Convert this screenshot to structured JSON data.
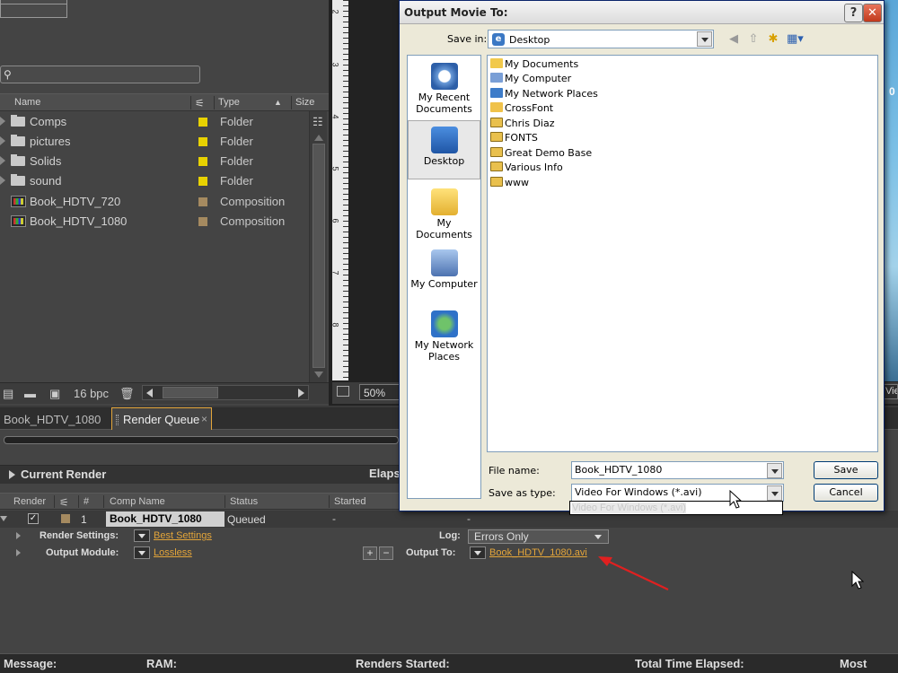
{
  "project_panel": {
    "search": {
      "placeholder": "",
      "value": ""
    },
    "columns": {
      "name": "Name",
      "type": "Type",
      "size": "Size"
    },
    "items": [
      {
        "name": "Comps",
        "type": "Folder",
        "kind": "folder",
        "label_color": "#e8d200"
      },
      {
        "name": "pictures",
        "type": "Folder",
        "kind": "folder",
        "label_color": "#e8d200"
      },
      {
        "name": "Solids",
        "type": "Folder",
        "kind": "folder",
        "label_color": "#e8d200"
      },
      {
        "name": "sound",
        "type": "Folder",
        "kind": "folder",
        "label_color": "#e8d200"
      },
      {
        "name": "Book_HDTV_720",
        "type": "Composition",
        "kind": "composition",
        "label_color": "#a58a60"
      },
      {
        "name": "Book_HDTV_1080",
        "type": "Composition",
        "kind": "composition",
        "label_color": "#a58a60"
      }
    ],
    "footer": {
      "bpc": "16 bpc"
    }
  },
  "viewer": {
    "zoom": "50%",
    "ruler_numbers": [
      "2",
      "3",
      "4",
      "5",
      "6",
      "7",
      "8"
    ],
    "view_label": "Vie",
    "edge_text": "0"
  },
  "render_queue": {
    "tabs": {
      "comp_tab": "Book_HDTV_1080",
      "render_queue_tab": "Render Queue",
      "close": "×"
    },
    "current_render": "Current Render",
    "elapsed": "Elaps",
    "headers": {
      "render": "Render",
      "number": "#",
      "comp_name": "Comp Name",
      "status": "Status",
      "started": "Started"
    },
    "item": {
      "number": "1",
      "comp_name": "Book_HDTV_1080",
      "status": "Queued",
      "started": "-",
      "render_time": "-",
      "checked": "✓"
    },
    "render_settings": {
      "label": "Render Settings:",
      "value": "Best Settings"
    },
    "log": {
      "label": "Log:",
      "value": "Errors Only"
    },
    "output_module": {
      "label": "Output Module:",
      "value": "Lossless"
    },
    "output_to": {
      "label": "Output To:",
      "value": "Book_HDTV_1080.avi"
    },
    "status_bar": {
      "message": "Message:",
      "ram": "RAM:",
      "renders_started": "Renders Started:",
      "total_time": "Total Time Elapsed:",
      "most_recent": "Most Rece"
    }
  },
  "dialog": {
    "title": "Output Movie To:",
    "help": "?",
    "close": "✕",
    "save_in_label": "Save in:",
    "save_in_value": "Desktop",
    "places": [
      {
        "label": "My Recent Documents",
        "icon": "recent-documents-icon",
        "selected": false
      },
      {
        "label": "Desktop",
        "icon": "desktop-icon",
        "selected": true
      },
      {
        "label": "My Documents",
        "icon": "my-documents-icon",
        "selected": false
      },
      {
        "label": "My Computer",
        "icon": "my-computer-icon",
        "selected": false
      },
      {
        "label": "My Network Places",
        "icon": "network-places-icon",
        "selected": false
      }
    ],
    "files": [
      {
        "name": "My Documents",
        "icon": "my-documents-icon"
      },
      {
        "name": "My Computer",
        "icon": "my-computer-icon"
      },
      {
        "name": "My Network Places",
        "icon": "network-places-icon"
      },
      {
        "name": "CrossFont",
        "icon": "folder-icon"
      },
      {
        "name": "Chris Diaz",
        "icon": "shared-folder-icon"
      },
      {
        "name": "FONTS",
        "icon": "shared-folder-icon"
      },
      {
        "name": "Great Demo Base",
        "icon": "shared-folder-icon"
      },
      {
        "name": "Various Info",
        "icon": "shared-folder-icon"
      },
      {
        "name": "www",
        "icon": "shared-folder-icon"
      }
    ],
    "file_name_label": "File name:",
    "file_name_value": "Book_HDTV_1080",
    "save_as_type_label": "Save as type:",
    "save_as_type_value": "Video For Windows (*.avi)",
    "save_as_type_options": [
      "Video For Windows (*.avi)"
    ],
    "save_button": "Save",
    "cancel_button": "Cancel"
  },
  "colors": {
    "accent_orange": "#e3a53a",
    "folder_label": "#e8d200",
    "composition_label": "#a58a60",
    "arrow_red": "#e02020"
  }
}
